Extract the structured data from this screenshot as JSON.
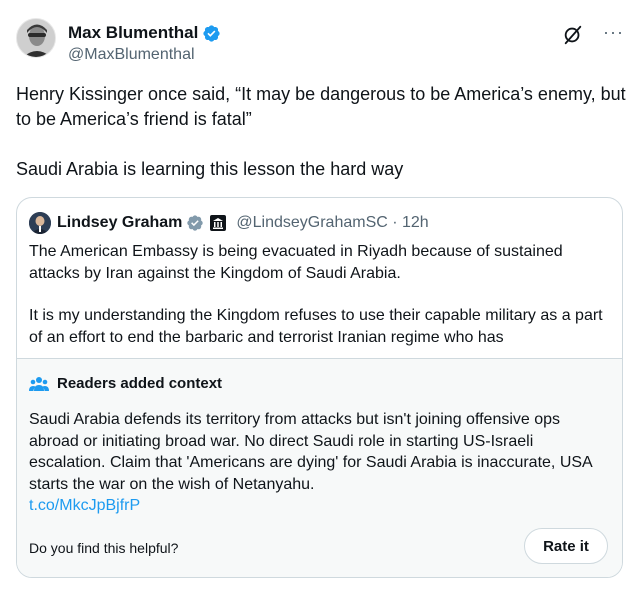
{
  "author": {
    "display_name": "Max Blumenthal",
    "handle": "@MaxBlumenthal"
  },
  "icons": {
    "verified": "verified-badge-icon",
    "grok": "grok-icon",
    "more": "more-options-icon",
    "gov": "government-label-icon",
    "community_notes": "community-notes-icon"
  },
  "colors": {
    "accent": "#1d9bf0",
    "text": "#0f1419",
    "muted": "#536471",
    "border": "#cfd9de",
    "context_bg": "#f7f9f9"
  },
  "tweet": {
    "paragraph_1": "Henry Kissinger once said, “It may be dangerous to be America’s enemy, but to be America’s friend is fatal”",
    "paragraph_2": "Saudi Arabia is learning this lesson the hard way"
  },
  "quote": {
    "display_name": "Lindsey Graham",
    "handle_time": "@LindseyGrahamSC · 12h",
    "paragraph_1": "The American Embassy is being evacuated in Riyadh because of sustained attacks by Iran against the Kingdom of Saudi Arabia.",
    "paragraph_2": "It is my understanding the Kingdom refuses to use their capable military as a part of an effort to end the barbaric and terrorist Iranian regime who has"
  },
  "context": {
    "title": "Readers added context",
    "body": "Saudi Arabia defends its territory from attacks but isn't joining offensive ops abroad or initiating broad war. No direct Saudi role in starting US-Israeli escalation. Claim that 'Americans are dying' for Saudi Arabia is inaccurate, USA starts the war on the wish of Netanyahu.",
    "link": "t.co/MkcJpBjfrP",
    "helpful_question": "Do you find this helpful?",
    "rate_label": "Rate it"
  },
  "more_glyph": "···"
}
